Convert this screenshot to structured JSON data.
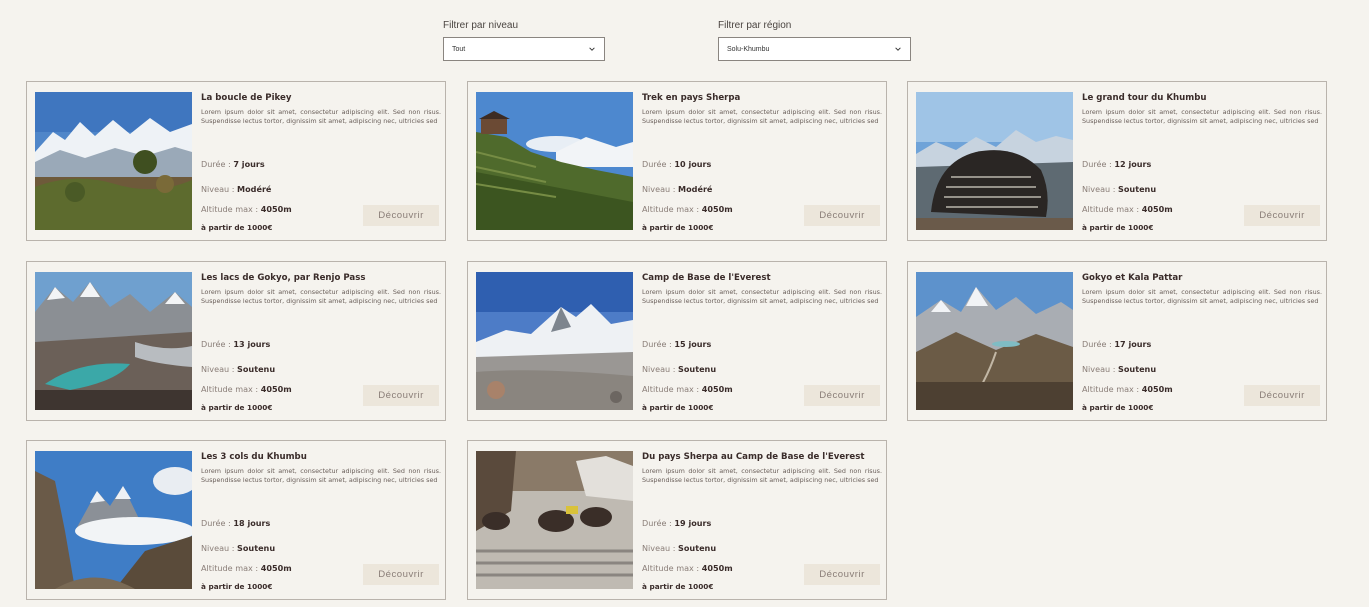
{
  "filters": {
    "level": {
      "label": "Filtrer par niveau",
      "value": "Tout"
    },
    "region": {
      "label": "Filtrer par région",
      "value": "Solu-Khumbu"
    }
  },
  "labels": {
    "duration": "Durée :",
    "level": "Niveau :",
    "altitude": "Altitude max :",
    "cta": "Découvrir"
  },
  "treks": [
    {
      "title": "La boucle de Pikey",
      "description": "Lorem ipsum dolor sit amet, consectetur adipiscing elit. Sed non risus. Suspendisse lectus tortor, dignissim sit amet, adipiscing nec, ultricies sed",
      "duration": "7 jours",
      "level": "Modéré",
      "altitude": "4050m",
      "price": "à partir de 1000€",
      "image": "himalaya-ridge-flowers"
    },
    {
      "title": "Trek en pays Sherpa",
      "description": "Lorem ipsum dolor sit amet, consectetur adipiscing elit. Sed non risus. Suspendisse lectus tortor, dignissim sit amet, adipiscing nec, ultricies sed",
      "duration": "10 jours",
      "level": "Modéré",
      "altitude": "4050m",
      "price": "à partir de 1000€",
      "image": "sherpa-village-terraces"
    },
    {
      "title": "Le grand tour du Khumbu",
      "description": "Lorem ipsum dolor sit amet, consectetur adipiscing elit. Sed non risus. Suspendisse lectus tortor, dignissim sit amet, adipiscing nec, ultricies sed",
      "duration": "12 jours",
      "level": "Soutenu",
      "altitude": "4050m",
      "price": "à partir de 1000€",
      "image": "mani-stone"
    },
    {
      "title": "Les lacs de Gokyo, par Renjo Pass",
      "description": "Lorem ipsum dolor sit amet, consectetur adipiscing elit. Sed non risus. Suspendisse lectus tortor, dignissim sit amet, adipiscing nec, ultricies sed",
      "duration": "13 jours",
      "level": "Soutenu",
      "altitude": "4050m",
      "price": "à partir de 1000€",
      "image": "gokyo-lake"
    },
    {
      "title": "Camp de Base de l'Everest",
      "description": "Lorem ipsum dolor sit amet, consectetur adipiscing elit. Sed non risus. Suspendisse lectus tortor, dignissim sit amet, adipiscing nec, ultricies sed",
      "duration": "15 jours",
      "level": "Soutenu",
      "altitude": "4050m",
      "price": "à partir de 1000€",
      "image": "everest-moraine"
    },
    {
      "title": "Gokyo et Kala Pattar",
      "description": "Lorem ipsum dolor sit amet, consectetur adipiscing elit. Sed non risus. Suspendisse lectus tortor, dignissim sit amet, adipiscing nec, ultricies sed",
      "duration": "17 jours",
      "level": "Soutenu",
      "altitude": "4050m",
      "price": "à partir de 1000€",
      "image": "valley-peaks"
    },
    {
      "title": "Les 3 cols du Khumbu",
      "description": "Lorem ipsum dolor sit amet, consectetur adipiscing elit. Sed non risus. Suspendisse lectus tortor, dignissim sit amet, adipiscing nec, ultricies sed",
      "duration": "18 jours",
      "level": "Soutenu",
      "altitude": "4050m",
      "price": "à partir de 1000€",
      "image": "peak-clouds"
    },
    {
      "title": "Du pays Sherpa au Camp de Base de l'Everest",
      "description": "Lorem ipsum dolor sit amet, consectetur adipiscing elit. Sed non risus. Suspendisse lectus tortor, dignissim sit amet, adipiscing nec, ultricies sed",
      "duration": "19 jours",
      "level": "Soutenu",
      "altitude": "4050m",
      "price": "à partir de 1000€",
      "image": "yaks-stairs"
    }
  ]
}
